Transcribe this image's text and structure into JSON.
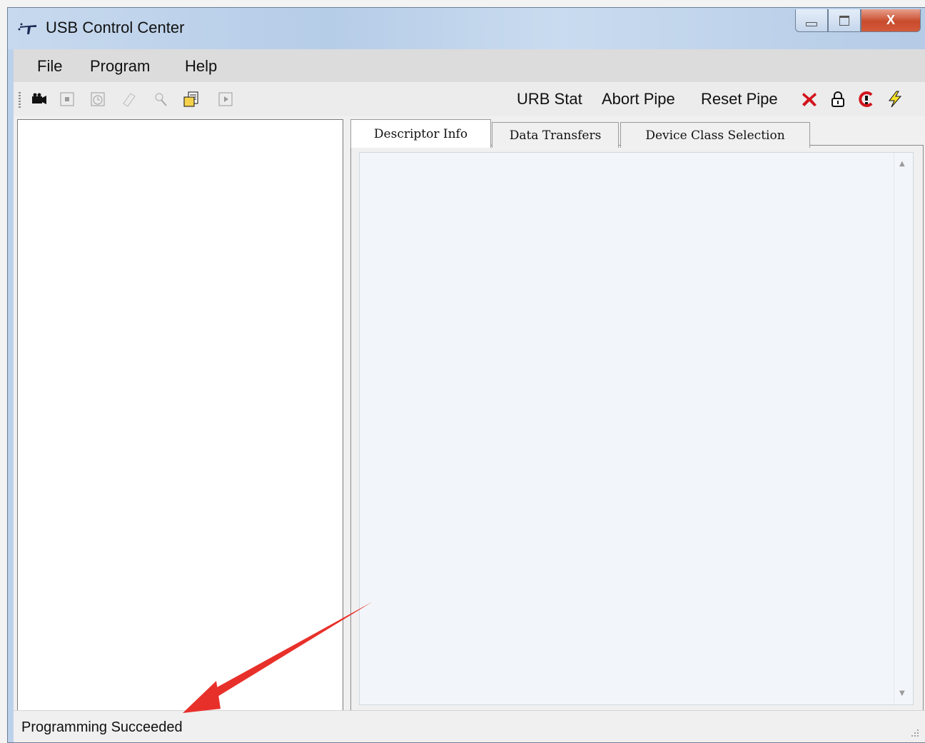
{
  "window": {
    "title": "USB Control Center",
    "close_glyph": "X"
  },
  "menu": {
    "items": [
      "File",
      "Program",
      "Help"
    ]
  },
  "toolbar": {
    "urb_stat": "URB Stat",
    "abort_pipe": "Abort Pipe",
    "reset_pipe": "Reset Pipe",
    "icons": [
      "camera-icon",
      "stop-icon",
      "timer-icon",
      "erase-icon",
      "search-icon",
      "document-icon",
      "play-icon",
      "red-x-icon",
      "lock-icon",
      "red-c-icon",
      "lightning-icon"
    ]
  },
  "tabs": [
    {
      "label": "Descriptor Info",
      "active": true
    },
    {
      "label": "Data Transfers",
      "active": false
    },
    {
      "label": "Device Class Selection",
      "active": false
    }
  ],
  "status": {
    "text": "Programming Succeeded"
  },
  "colors": {
    "annotation_arrow": "#e8302a",
    "title_bar": "#bcd1ea",
    "close_button": "#c84b2c"
  }
}
